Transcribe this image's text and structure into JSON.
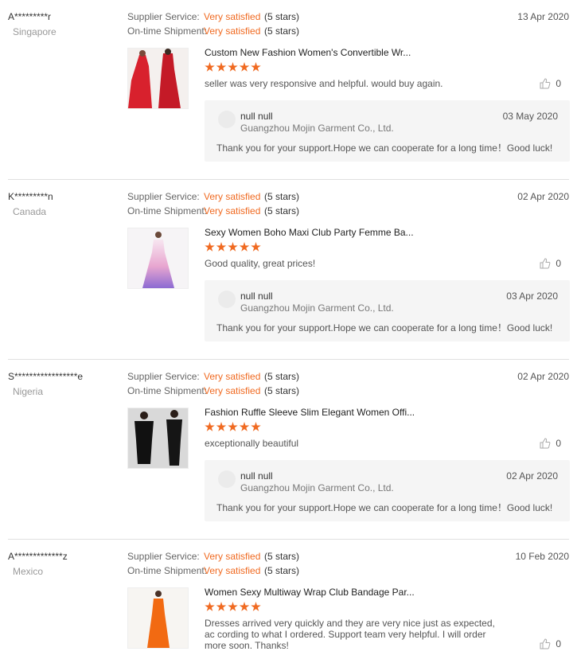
{
  "labels": {
    "supplier_service": "Supplier Service:",
    "shipment": "On-time Shipment:"
  },
  "colors": {
    "accent": "#f06a21"
  },
  "reviews": [
    {
      "buyer": "A*********r",
      "country": "Singapore",
      "supplier_value": "Very satisfied",
      "supplier_stars": "(5 stars)",
      "shipment_value": "Very satisfied",
      "shipment_stars": "(5 stars)",
      "date": "13 Apr 2020",
      "product_title": "Custom New Fashion Women's Convertible Wr...",
      "rating": 5,
      "comment": "seller was very responsive and helpful. would buy again.",
      "likes": "0",
      "reply": {
        "name": "null null",
        "shop": "Guangzhou Mojin Garment Co., Ltd.",
        "date": "03 May 2020",
        "text": "Thank you for your support.Hope we can cooperate for a long time！Good luck!"
      }
    },
    {
      "buyer": "K*********n",
      "country": "Canada",
      "supplier_value": "Very satisfied",
      "supplier_stars": "(5 stars)",
      "shipment_value": "Very satisfied",
      "shipment_stars": "(5 stars)",
      "date": "02 Apr 2020",
      "product_title": "Sexy Women Boho Maxi Club Party Femme Ba...",
      "rating": 5,
      "comment": "Good quality, great prices!",
      "likes": "0",
      "reply": {
        "name": "null null",
        "shop": "Guangzhou Mojin Garment Co., Ltd.",
        "date": "03 Apr 2020",
        "text": "Thank you for your support.Hope we can cooperate for a long time！Good luck!"
      }
    },
    {
      "buyer": "S*****************e",
      "country": "Nigeria",
      "supplier_value": "Very satisfied",
      "supplier_stars": "(5 stars)",
      "shipment_value": "Very satisfied",
      "shipment_stars": "(5 stars)",
      "date": "02 Apr 2020",
      "product_title": "Fashion Ruffle Sleeve Slim Elegant Women Offi...",
      "rating": 5,
      "comment": "exceptionally beautiful",
      "likes": "0",
      "reply": {
        "name": "null null",
        "shop": "Guangzhou Mojin Garment Co., Ltd.",
        "date": "02 Apr 2020",
        "text": "Thank you for your support.Hope we can cooperate for a long time！Good luck!"
      }
    },
    {
      "buyer": "A*************z",
      "country": "Mexico",
      "supplier_value": "Very satisfied",
      "supplier_stars": "(5 stars)",
      "shipment_value": "Very satisfied",
      "shipment_stars": "(5 stars)",
      "date": "10 Feb 2020",
      "product_title": "Women Sexy Multiway Wrap Club Bandage Par...",
      "rating": 5,
      "comment": "Dresses arrived very quickly and they are very nice just as expected, ac cording to what I ordered. Support team very helpful. I will order more soon. Thanks!",
      "likes": "0"
    }
  ]
}
